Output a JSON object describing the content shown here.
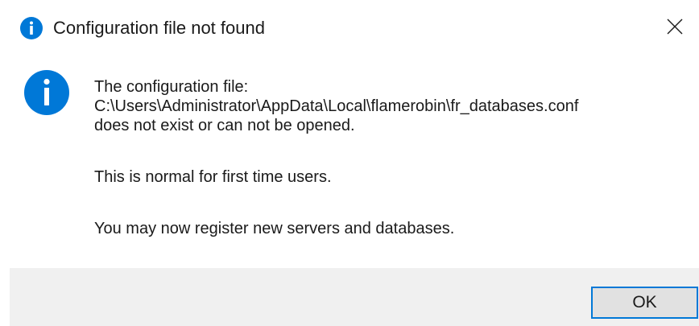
{
  "window": {
    "title": "Configuration file not found",
    "icon": "info-icon",
    "close_icon": "close-icon"
  },
  "message": {
    "icon": "info-icon",
    "lines": [
      "The configuration file:",
      "C:\\Users\\Administrator\\AppData\\Local\\flamerobin\\fr_databases.conf",
      "does not exist or can not be opened.",
      "This is normal for first time users.",
      "You may now register new servers and databases."
    ]
  },
  "buttons": {
    "ok_label": "OK"
  },
  "colors": {
    "info_blue": "#0078d7",
    "footer_bg": "#f0f0f0",
    "button_bg": "#e1e1e1",
    "text": "#1a1a1a"
  }
}
